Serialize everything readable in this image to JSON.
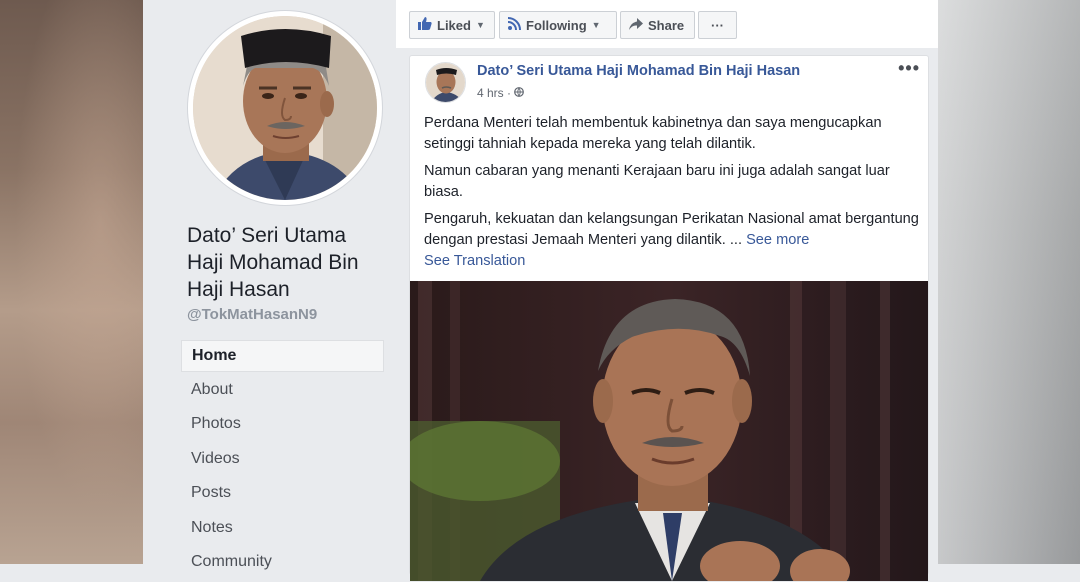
{
  "page": {
    "name": "Dato’ Seri Utama Haji Mohamad Bin Haji Hasan",
    "handle": "@TokMatHasanN9"
  },
  "nav": {
    "items": [
      {
        "label": "Home"
      },
      {
        "label": "About"
      },
      {
        "label": "Photos"
      },
      {
        "label": "Videos"
      },
      {
        "label": "Posts"
      },
      {
        "label": "Notes"
      },
      {
        "label": "Community"
      }
    ]
  },
  "actions": {
    "liked_label": "Liked",
    "following_label": "Following",
    "share_label": "Share",
    "more_label": "···"
  },
  "post": {
    "author": "Dato’ Seri Utama Haji Mohamad Bin Haji Hasan",
    "time": "4 hrs",
    "audience_sep": "·",
    "more_label": "•••",
    "paragraphs": [
      "Perdana Menteri telah membentuk kabinetnya dan saya mengucapkan setinggi tahniah kepada mereka yang telah dilantik.",
      "Namun cabaran yang menanti Kerajaan baru ini juga adalah sangat luar biasa.",
      "Pengaruh, kekuatan dan kelangsungan Perikatan Nasional amat bergantung dengan prestasi Jemaah Menteri yang dilantik."
    ],
    "ellipsis": " ... ",
    "see_more": "See more",
    "see_translation": "See Translation"
  },
  "colors": {
    "accent": "#385898",
    "background": "#e9ebee"
  },
  "icons": {
    "liked": "thumbs-up-icon",
    "following": "rss-icon",
    "share": "share-arrow-icon",
    "globe": "globe-icon"
  }
}
